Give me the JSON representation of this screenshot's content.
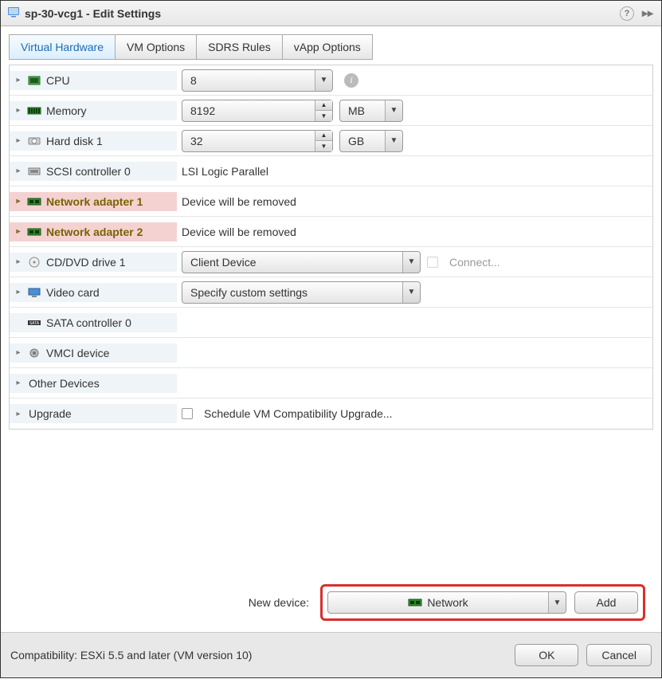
{
  "window": {
    "title": "sp-30-vcg1 - Edit Settings"
  },
  "tabs": [
    {
      "label": "Virtual Hardware",
      "active": true
    },
    {
      "label": "VM Options",
      "active": false
    },
    {
      "label": "SDRS Rules",
      "active": false
    },
    {
      "label": "vApp Options",
      "active": false
    }
  ],
  "rows": {
    "cpu": {
      "label": "CPU",
      "value": "8"
    },
    "memory": {
      "label": "Memory",
      "value": "8192",
      "unit": "MB"
    },
    "harddisk": {
      "label": "Hard disk 1",
      "value": "32",
      "unit": "GB"
    },
    "scsi": {
      "label": "SCSI controller 0",
      "value": "LSI Logic Parallel"
    },
    "net1": {
      "label": "Network adapter 1",
      "value": "Device will be removed"
    },
    "net2": {
      "label": "Network adapter 2",
      "value": "Device will be removed"
    },
    "cddvd": {
      "label": "CD/DVD drive 1",
      "value": "Client Device",
      "connect": "Connect..."
    },
    "video": {
      "label": "Video card",
      "value": "Specify custom settings"
    },
    "sata": {
      "label": "SATA controller 0"
    },
    "vmci": {
      "label": "VMCI device"
    },
    "other": {
      "label": "Other Devices"
    },
    "upgrade": {
      "label": "Upgrade",
      "checkbox_label": "Schedule VM Compatibility Upgrade..."
    }
  },
  "new_device": {
    "label": "New device:",
    "selected": "Network",
    "add_label": "Add"
  },
  "footer": {
    "compat": "Compatibility: ESXi 5.5 and later (VM version 10)",
    "ok": "OK",
    "cancel": "Cancel"
  }
}
